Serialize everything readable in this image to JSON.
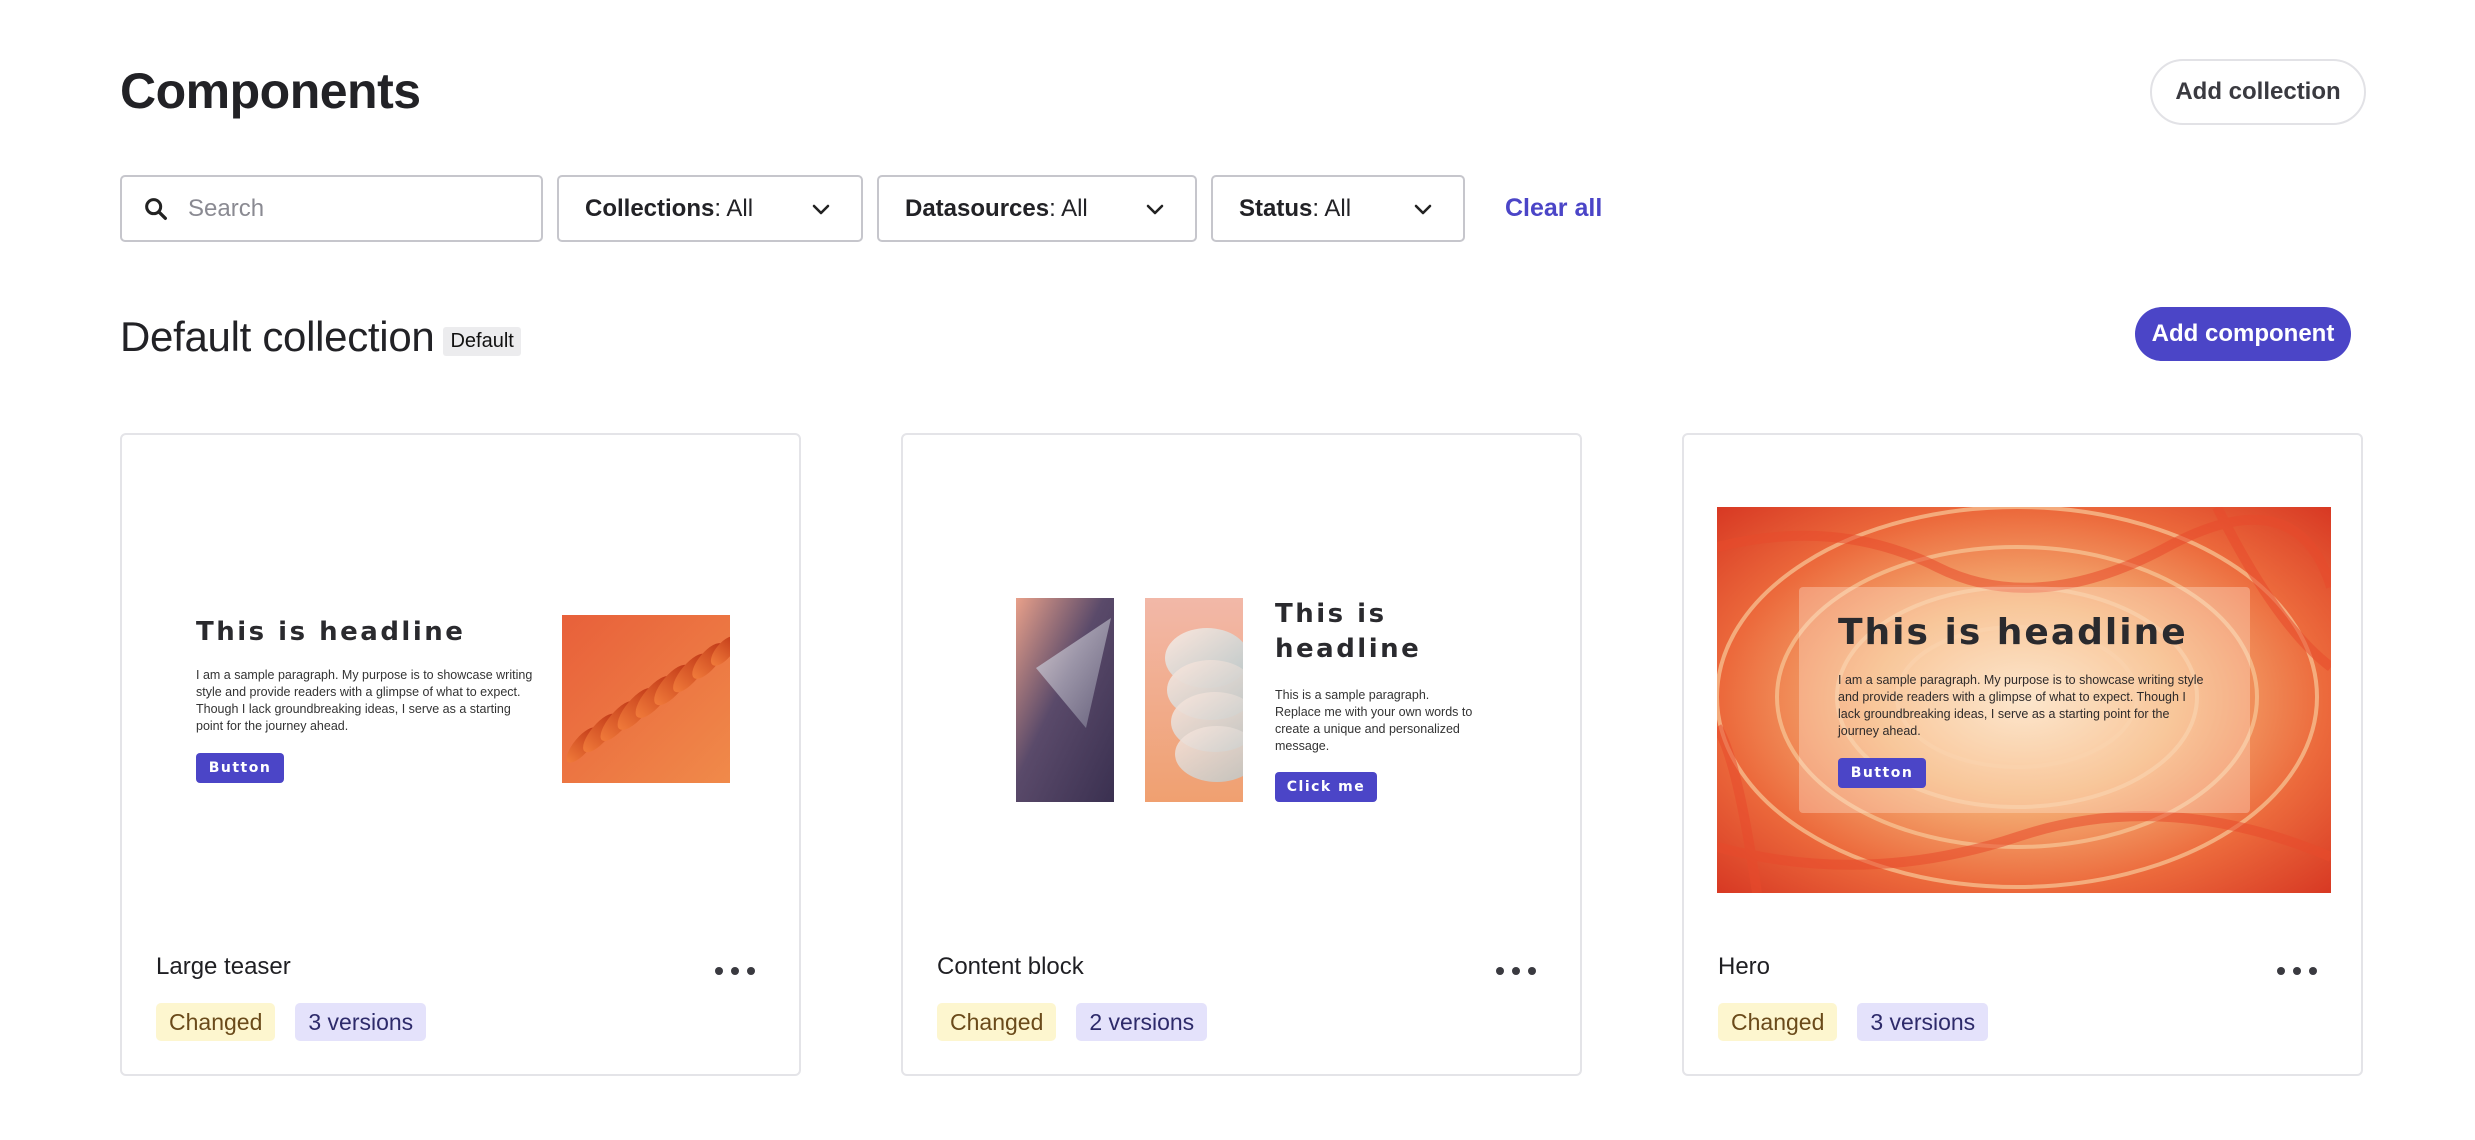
{
  "header": {
    "title": "Components",
    "add_collection_label": "Add collection"
  },
  "filters": {
    "search": {
      "placeholder": "Search",
      "value": ""
    },
    "collections": {
      "label": "Collections",
      "value": ": All"
    },
    "datasources": {
      "label": "Datasources",
      "value": ": All"
    },
    "status": {
      "label": "Status",
      "value": ": All"
    },
    "clear_all_label": "Clear all"
  },
  "section": {
    "title": "Default collection",
    "tag": "Default",
    "add_component_label": "Add component"
  },
  "cards": [
    {
      "name": "Large teaser",
      "status": "Changed",
      "versions": "3 versions",
      "preview": {
        "headline": "This is headline",
        "paragraph": "I am a sample paragraph. My purpose is to showcase writing style and provide readers with a glimpse of what to expect. Though I lack groundbreaking ideas, I serve as a starting point for the journey ahead.",
        "button": "Button"
      }
    },
    {
      "name": "Content block",
      "status": "Changed",
      "versions": "2 versions",
      "preview": {
        "headline": "This is headline",
        "paragraph": "This is a sample paragraph. Replace me with your own words to create a unique and personalized message.",
        "button": "Click me"
      }
    },
    {
      "name": "Hero",
      "status": "Changed",
      "versions": "3 versions",
      "preview": {
        "headline": "This is headline",
        "paragraph": "I am a sample paragraph. My purpose is to showcase writing style and provide readers with a glimpse of what to expect. Though I lack groundbreaking ideas, I serve as a starting point for the journey ahead.",
        "button": "Button"
      }
    }
  ],
  "colors": {
    "accent": "#4b45c7",
    "changed_bg": "#fdf6cf",
    "versions_bg": "#e4e2fb"
  }
}
